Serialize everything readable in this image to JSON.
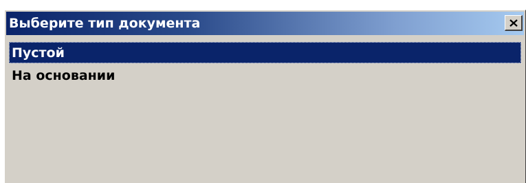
{
  "window": {
    "title": "Выберите тип документа",
    "close_icon": "close-icon",
    "colors": {
      "titlebar_start": "#0a246a",
      "titlebar_end": "#a6caf0",
      "face": "#d4d0c8",
      "selection": "#0a246a"
    }
  },
  "list": {
    "items": [
      {
        "label": "Пустой",
        "selected": true
      },
      {
        "label": "На основании",
        "selected": false
      }
    ]
  }
}
